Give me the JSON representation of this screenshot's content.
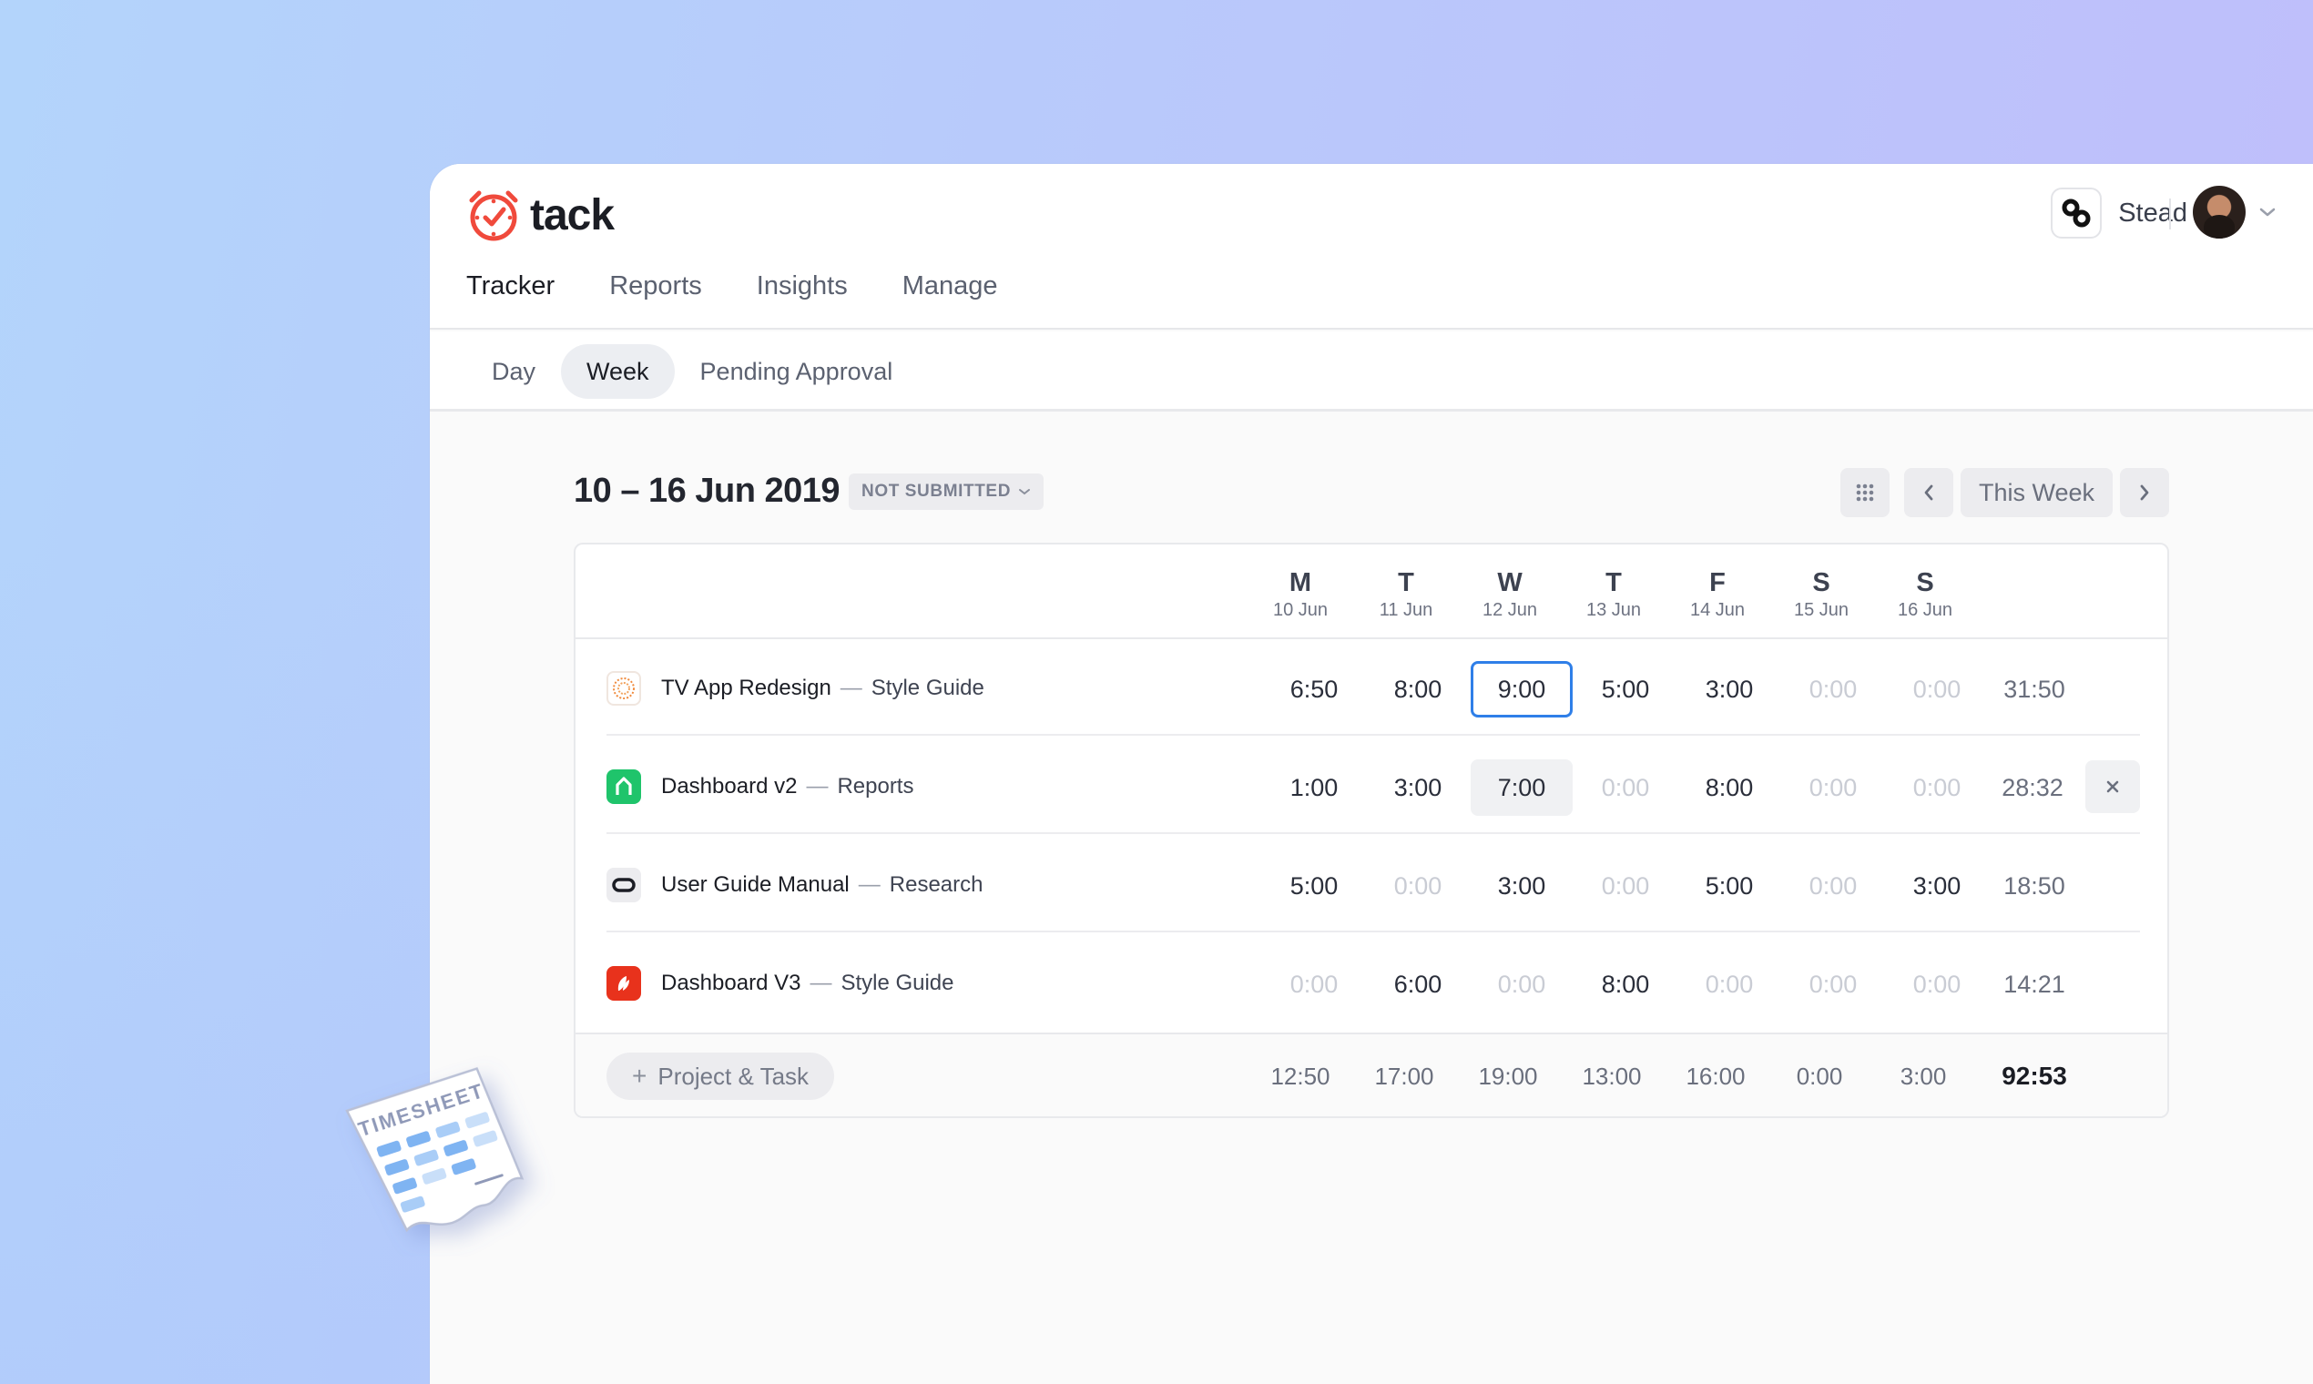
{
  "app": {
    "name": "tack"
  },
  "nav": {
    "items": [
      "Tracker",
      "Reports",
      "Insights",
      "Manage"
    ],
    "active": "Tracker"
  },
  "workspace": {
    "name": "Stead"
  },
  "subtabs": {
    "items": [
      "Day",
      "Week",
      "Pending Approval"
    ],
    "active": "Week"
  },
  "week": {
    "title": "10 – 16 Jun 2019",
    "status": "NOT SUBMITTED",
    "this_week_label": "This Week"
  },
  "days": [
    {
      "letter": "M",
      "date": "10 Jun"
    },
    {
      "letter": "T",
      "date": "11 Jun"
    },
    {
      "letter": "W",
      "date": "12 Jun"
    },
    {
      "letter": "T",
      "date": "13 Jun"
    },
    {
      "letter": "F",
      "date": "14 Jun"
    },
    {
      "letter": "S",
      "date": "15 Jun"
    },
    {
      "letter": "S",
      "date": "16 Jun"
    }
  ],
  "rows": [
    {
      "project": "TV App Redesign",
      "task": "Style Guide",
      "icon": "sun-logo-icon",
      "icon_color": "#f08a3c",
      "hours": [
        "6:50",
        "8:00",
        "9:00",
        "5:00",
        "3:00",
        "0:00",
        "0:00"
      ],
      "total": "31:50"
    },
    {
      "project": "Dashboard v2",
      "task": "Reports",
      "icon": "house-logo-icon",
      "icon_color": "#1fc46b",
      "hours": [
        "1:00",
        "3:00",
        "7:00",
        "0:00",
        "8:00",
        "0:00",
        "0:00"
      ],
      "total": "28:32"
    },
    {
      "project": "User Guide Manual",
      "task": "Research",
      "icon": "pill-logo-icon",
      "icon_color": "#1b1d24",
      "hours": [
        "5:00",
        "0:00",
        "3:00",
        "0:00",
        "5:00",
        "0:00",
        "3:00"
      ],
      "total": "18:50"
    },
    {
      "project": "Dashboard V3",
      "task": "Style Guide",
      "icon": "leaf-logo-icon",
      "icon_color": "#e8321c",
      "hours": [
        "0:00",
        "6:00",
        "0:00",
        "8:00",
        "0:00",
        "0:00",
        "0:00"
      ],
      "total": "14:21"
    }
  ],
  "footer": {
    "add_label": "Project & Task",
    "day_totals": [
      "12:50",
      "17:00",
      "19:00",
      "13:00",
      "16:00",
      "0:00",
      "3:00"
    ],
    "grand_total": "92:53"
  },
  "sticker": {
    "label": "TIMESHEET"
  },
  "colors": {
    "accent": "#2f7fe8",
    "brand": "#f04a3c"
  }
}
